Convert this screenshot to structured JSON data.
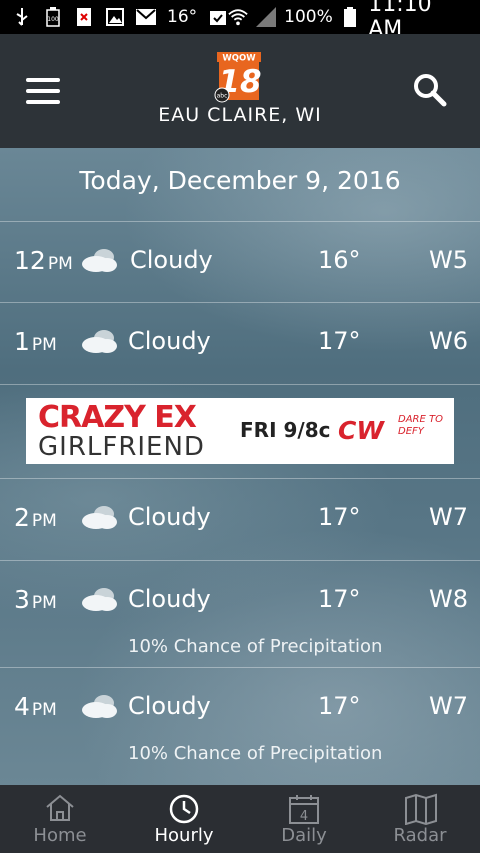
{
  "status_bar": {
    "temperature": "16°",
    "battery_level": "100%",
    "battery_icon_text": "100",
    "time": "11:10 AM"
  },
  "header": {
    "logo_top": "WQOW",
    "logo_number": "18",
    "logo_network": "abc",
    "location": "EAU CLAIRE, WI"
  },
  "main": {
    "date_title": "Today, December 9, 2016",
    "hours": [
      {
        "hour": "12",
        "ampm": "PM",
        "condition": "Cloudy",
        "temp": "16°",
        "wind": "W5",
        "precip": ""
      },
      {
        "hour": "1",
        "ampm": "PM",
        "condition": "Cloudy",
        "temp": "17°",
        "wind": "W6",
        "precip": ""
      },
      {
        "hour": "2",
        "ampm": "PM",
        "condition": "Cloudy",
        "temp": "17°",
        "wind": "W7",
        "precip": ""
      },
      {
        "hour": "3",
        "ampm": "PM",
        "condition": "Cloudy",
        "temp": "17°",
        "wind": "W8",
        "precip": "10% Chance of Precipitation"
      },
      {
        "hour": "4",
        "ampm": "PM",
        "condition": "Cloudy",
        "temp": "17°",
        "wind": "W7",
        "precip": "10% Chance of Precipitation"
      }
    ]
  },
  "ad": {
    "line1": "CRAZY EX",
    "line2": "GIRLFRIEND",
    "schedule": "FRI 9/8c",
    "network": "CW",
    "tagline": "DARE TO DEFY"
  },
  "tabs": [
    {
      "label": "Home",
      "active": false
    },
    {
      "label": "Hourly",
      "active": true
    },
    {
      "label": "Daily",
      "active": false,
      "badge": "4"
    },
    {
      "label": "Radar",
      "active": false
    }
  ],
  "colors": {
    "appbar": "#2d3338",
    "tabbar": "#2b2e33",
    "ad_red": "#d9232d",
    "logo_orange": "#e8661f"
  }
}
